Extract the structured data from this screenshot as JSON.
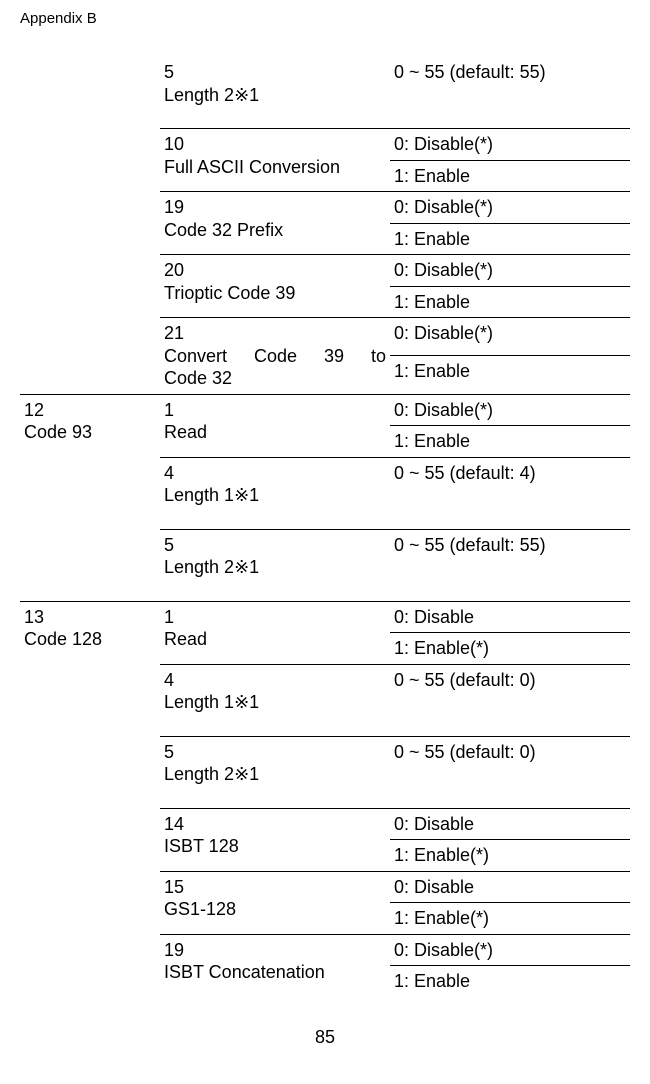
{
  "header": "Appendix B",
  "footer": "85",
  "rows": [
    {
      "c1": "",
      "c2_a": "5",
      "c2_b": "Length 2※1",
      "c3": "0 ~ 55 (default: 55)",
      "kind": "single-tall"
    },
    {
      "c1": "",
      "c2_a": "10",
      "c2_b": "Full ASCII Conversion",
      "c3a": "0: Disable(*)",
      "c3b": "1: Enable",
      "kind": "pair"
    },
    {
      "c1": "",
      "c2_a": "19",
      "c2_b": "Code 32 Prefix",
      "c3a": "0: Disable(*)",
      "c3b": "1: Enable",
      "kind": "pair"
    },
    {
      "c1": "",
      "c2_a": "20",
      "c2_b": "Trioptic Code 39",
      "c3a": "0: Disable(*)",
      "c3b": "1: Enable",
      "kind": "pair"
    },
    {
      "c1": "",
      "c2_a": "21",
      "c2_just": "Convert Code 39 to",
      "c2_last": "Code 32",
      "c3a": "0: Disable(*)",
      "c3b": "1: Enable",
      "kind": "pair3"
    },
    {
      "c1a": "12",
      "c1b": "Code 93",
      "c2_a": "1",
      "c2_b": "Read",
      "c3a": "0: Disable(*)",
      "c3b": "1: Enable",
      "kind": "pair-c1"
    },
    {
      "c1": "",
      "c2_a": "4",
      "c2_b": "Length 1※1",
      "c3": "0 ~ 55 (default: 4)",
      "kind": "single-tall"
    },
    {
      "c1": "",
      "c2_a": "5",
      "c2_b": "Length 2※1",
      "c3": "0 ~ 55 (default: 55)",
      "kind": "single-tall"
    },
    {
      "c1a": "13",
      "c1b": "Code 128",
      "c2_a": "1",
      "c2_b": "Read",
      "c3a": "0: Disable",
      "c3b": "1: Enable(*)",
      "kind": "pair-c1"
    },
    {
      "c1": "",
      "c2_a": "4",
      "c2_b": "Length 1※1",
      "c3": "0 ~ 55 (default: 0)",
      "kind": "single-tall"
    },
    {
      "c1": "",
      "c2_a": "5",
      "c2_b": "Length 2※1",
      "c3": "0 ~ 55 (default: 0)",
      "kind": "single-tall"
    },
    {
      "c1": "",
      "c2_a": "14",
      "c2_b": "ISBT 128",
      "c3a": "0: Disable",
      "c3b": "1: Enable(*)",
      "kind": "pair"
    },
    {
      "c1": "",
      "c2_a": "15",
      "c2_b": "GS1-128",
      "c3a": "0: Disable",
      "c3b": "1: Enable(*)",
      "kind": "pair"
    },
    {
      "c1": "",
      "c2_a": "19",
      "c2_b": "ISBT Concatenation",
      "c3a": "0: Disable(*)",
      "c3b": "1: Enable",
      "kind": "pair"
    }
  ]
}
